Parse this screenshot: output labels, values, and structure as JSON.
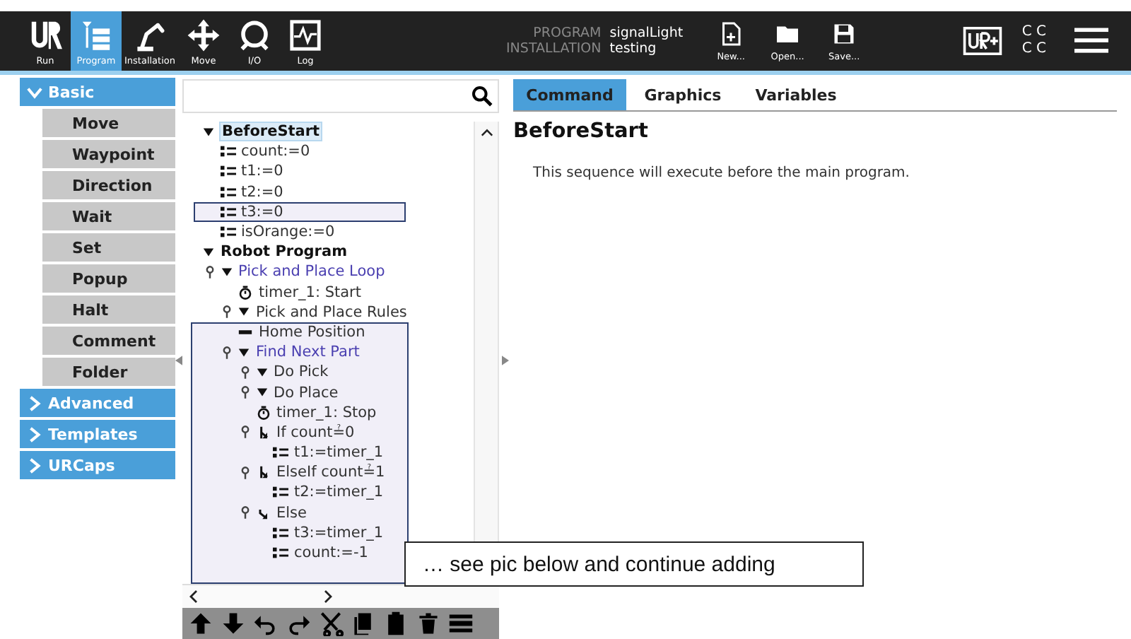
{
  "top_bar": {
    "nav": [
      {
        "label": "Run",
        "kind": "logo",
        "selected": false
      },
      {
        "label": "Program",
        "kind": "program",
        "selected": true
      },
      {
        "label": "Installation",
        "kind": "robot",
        "selected": false
      },
      {
        "label": "Move",
        "kind": "move",
        "selected": false
      },
      {
        "label": "I/O",
        "kind": "io",
        "selected": false
      },
      {
        "label": "Log",
        "kind": "log",
        "selected": false
      }
    ],
    "program_label": "PROGRAM",
    "program_name": "signalLight",
    "installation_label": "INSTALLATION",
    "installation_name": "testing",
    "file_buttons": [
      {
        "label": "New...",
        "kind": "new"
      },
      {
        "label": "Open...",
        "kind": "open"
      },
      {
        "label": "Save...",
        "kind": "save"
      }
    ],
    "status": [
      "C C",
      "C C"
    ]
  },
  "sidebar": {
    "groups": [
      {
        "label": "Basic",
        "expanded": true,
        "items": [
          "Move",
          "Waypoint",
          "Direction",
          "Wait",
          "Set",
          "Popup",
          "Halt",
          "Comment",
          "Folder"
        ]
      },
      {
        "label": "Advanced",
        "expanded": false
      },
      {
        "label": "Templates",
        "expanded": false
      },
      {
        "label": "URCaps",
        "expanded": false
      }
    ]
  },
  "tree": {
    "nodes": [
      {
        "label": "BeforeStart",
        "kind": "section",
        "expanded": true,
        "selected": true,
        "children": [
          {
            "label": "count:=0",
            "kind": "assign",
            "pinned": false,
            "selected": false
          },
          {
            "label": "t1:=0",
            "kind": "assign",
            "pinned": false,
            "selected": false
          },
          {
            "label": "t2:=0",
            "kind": "assign",
            "pinned": false,
            "selected": false
          },
          {
            "label": "t3:=0",
            "kind": "assign",
            "pinned": false,
            "selected": false
          },
          {
            "label": "isOrange:=0",
            "kind": "assign",
            "pinned": false,
            "selected": false
          }
        ]
      },
      {
        "label": "Robot Program",
        "kind": "section",
        "expanded": true,
        "selected": false,
        "children": [
          {
            "label": "Pick and Place Loop",
            "kind": "loop",
            "expanded": true,
            "pinned": true,
            "selected": false,
            "children": [
              {
                "label": "timer_1: Start",
                "kind": "timer",
                "pinned": false,
                "selected": false
              },
              {
                "label": "Pick and Place Rules",
                "kind": "folder",
                "expanded": true,
                "pinned": true,
                "selected": false
              },
              {
                "label": "Home Position",
                "kind": "waypoint",
                "pinned": false,
                "selected": false
              },
              {
                "label": "Find Next Part",
                "kind": "loop",
                "expanded": true,
                "pinned": true,
                "selected": false,
                "children": [
                  {
                    "label": "Do Pick",
                    "kind": "folder",
                    "expanded": true,
                    "pinned": true,
                    "selected": false
                  },
                  {
                    "label": "Do Place",
                    "kind": "folder",
                    "expanded": true,
                    "pinned": true,
                    "selected": false
                  },
                  {
                    "label": "timer_1: Stop",
                    "kind": "timer",
                    "pinned": false,
                    "selected": false
                  },
                  {
                    "label": "If count≟0",
                    "kind": "if",
                    "pinned": true,
                    "selected": false,
                    "children": [
                      {
                        "label": "t1:=timer_1",
                        "kind": "assign",
                        "pinned": false,
                        "selected": false
                      }
                    ]
                  },
                  {
                    "label": "ElseIf count≟1",
                    "kind": "if",
                    "pinned": true,
                    "selected": false,
                    "children": [
                      {
                        "label": "t2:=timer_1",
                        "kind": "assign",
                        "pinned": false,
                        "selected": false
                      }
                    ]
                  },
                  {
                    "label": "Else",
                    "kind": "else",
                    "pinned": true,
                    "selected": false,
                    "children": [
                      {
                        "label": "t3:=timer_1",
                        "kind": "assign",
                        "pinned": false,
                        "selected": false
                      },
                      {
                        "label": "count:=-1",
                        "kind": "assign",
                        "pinned": false,
                        "selected": false
                      }
                    ]
                  }
                ]
              }
            ]
          }
        ]
      }
    ]
  },
  "tabs": [
    {
      "label": "Command",
      "selected": true
    },
    {
      "label": "Graphics",
      "selected": false
    },
    {
      "label": "Variables",
      "selected": false
    }
  ],
  "command": {
    "title": "BeforeStart",
    "description": "This sequence will execute before the main program."
  },
  "callout": "… see pic below and continue adding"
}
